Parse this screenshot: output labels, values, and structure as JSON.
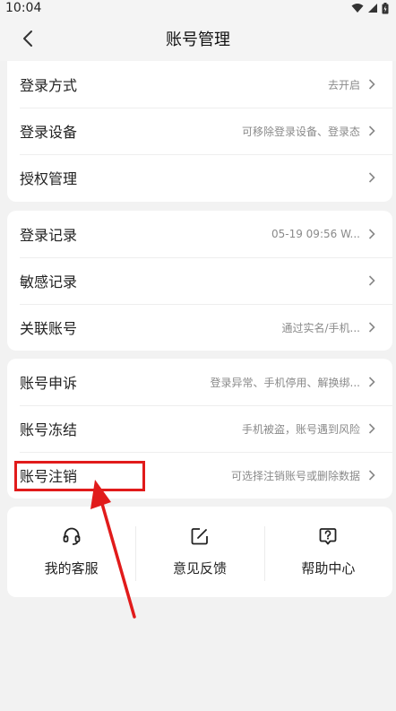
{
  "status_bar": {
    "time": "10:04"
  },
  "header": {
    "title": "账号管理"
  },
  "groups": [
    {
      "items": [
        {
          "label": "登录方式",
          "value": "去开启"
        },
        {
          "label": "登录设备",
          "value": "可移除登录设备、登录态"
        },
        {
          "label": "授权管理",
          "value": ""
        }
      ]
    },
    {
      "items": [
        {
          "label": "登录记录",
          "value": "05-19 09:56 W..."
        },
        {
          "label": "敏感记录",
          "value": ""
        },
        {
          "label": "关联账号",
          "value": "通过实名/手机..."
        }
      ]
    },
    {
      "items": [
        {
          "label": "账号申诉",
          "value": "登录异常、手机停用、解换绑..."
        },
        {
          "label": "账号冻结",
          "value": "手机被盗，账号遇到风险"
        },
        {
          "label": "账号注销",
          "value": "可选择注销账号或删除数据"
        }
      ]
    }
  ],
  "shortcuts": [
    {
      "label": "我的客服",
      "icon": "headset-icon"
    },
    {
      "label": "意见反馈",
      "icon": "edit-icon"
    },
    {
      "label": "帮助中心",
      "icon": "help-icon"
    }
  ],
  "annotation": {
    "color": "#e11b1b"
  }
}
